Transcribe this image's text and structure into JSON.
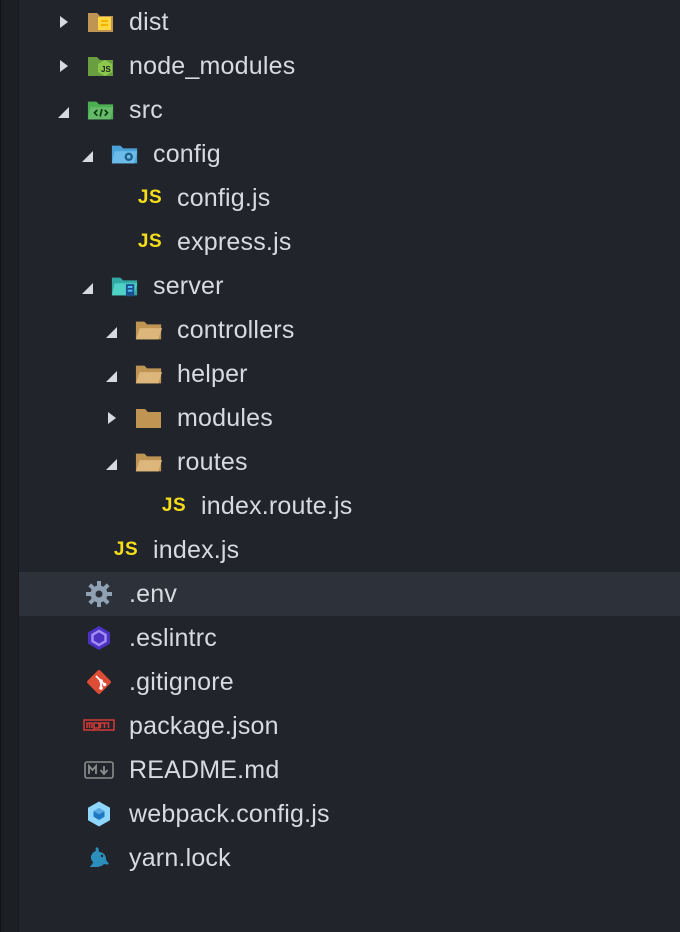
{
  "explorer": {
    "items": [
      {
        "label": "dist",
        "icon": "dist-folder-icon",
        "state": "collapsed"
      },
      {
        "label": "node_modules",
        "icon": "node-modules-folder-icon",
        "state": "collapsed"
      },
      {
        "label": "src",
        "icon": "src-folder-icon",
        "state": "expanded"
      },
      {
        "label": "config",
        "icon": "config-folder-icon",
        "state": "expanded"
      },
      {
        "label": "config.js",
        "icon": "js-file-icon"
      },
      {
        "label": "express.js",
        "icon": "js-file-icon"
      },
      {
        "label": "server",
        "icon": "server-folder-icon",
        "state": "expanded"
      },
      {
        "label": "controllers",
        "icon": "folder-open-icon",
        "state": "expanded"
      },
      {
        "label": "helper",
        "icon": "folder-open-icon",
        "state": "expanded"
      },
      {
        "label": "modules",
        "icon": "folder-icon",
        "state": "collapsed"
      },
      {
        "label": "routes",
        "icon": "folder-open-icon",
        "state": "expanded"
      },
      {
        "label": "index.route.js",
        "icon": "js-file-icon"
      },
      {
        "label": "index.js",
        "icon": "js-file-icon"
      },
      {
        "label": ".env",
        "icon": "gear-icon",
        "selected": true
      },
      {
        "label": ".eslintrc",
        "icon": "eslint-icon"
      },
      {
        "label": ".gitignore",
        "icon": "git-icon"
      },
      {
        "label": "package.json",
        "icon": "npm-icon"
      },
      {
        "label": "README.md",
        "icon": "markdown-icon"
      },
      {
        "label": "webpack.config.js",
        "icon": "webpack-icon"
      },
      {
        "label": "yarn.lock",
        "icon": "yarn-icon"
      }
    ],
    "js_badge": "JS",
    "npm_badge": "npm",
    "md_badge": "M↓"
  },
  "colors": {
    "background": "#21252b",
    "selected_row": "#2c313a",
    "text": "#d7dae0",
    "js_yellow": "#f5de19",
    "folder_tan": "#c09553",
    "git_red": "#dd4c35",
    "npm_red": "#cb3837",
    "eslint_purple": "#4b32c3",
    "webpack_blue": "#8ed6fb"
  }
}
